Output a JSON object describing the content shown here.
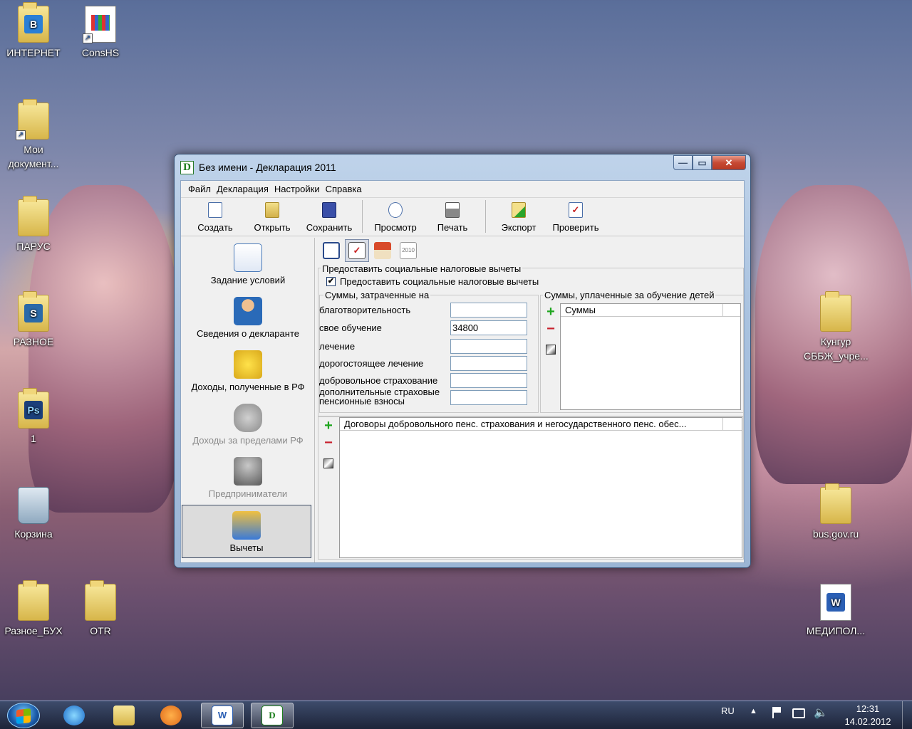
{
  "desktop": {
    "icons": [
      {
        "label": "ИНТЕРНЕТ",
        "icon": "folder-icon"
      },
      {
        "label": "ConsHS",
        "icon": "application-icon"
      },
      {
        "label": "Мои документ...",
        "icon": "folder-shortcut-icon"
      },
      {
        "label": "ПАРУС",
        "icon": "folder-icon"
      },
      {
        "label": "РАЗНОЕ",
        "icon": "folder-icon"
      },
      {
        "label": "1",
        "icon": "photoshop-folder-icon"
      },
      {
        "label": "Корзина",
        "icon": "recycle-bin-icon"
      },
      {
        "label": "Разное_БУХ",
        "icon": "folder-icon"
      },
      {
        "label": "OTR",
        "icon": "folder-icon"
      },
      {
        "label": "Кунгур СББЖ_учре...",
        "icon": "folder-icon"
      },
      {
        "label": "bus.gov.ru",
        "icon": "folder-icon"
      },
      {
        "label": "МЕДИПОЛ...",
        "icon": "word-document-icon"
      }
    ]
  },
  "window": {
    "title": "Без имени - Декларация 2011",
    "app_icon_letter": "D"
  },
  "menu": [
    "Файл",
    "Декларация",
    "Настройки",
    "Справка"
  ],
  "toolbar": {
    "create": "Создать",
    "open": "Открыть",
    "save": "Сохранить",
    "preview": "Просмотр",
    "print": "Печать",
    "export": "Экспорт",
    "check": "Проверить"
  },
  "nav": [
    {
      "label": "Задание условий",
      "enabled": true
    },
    {
      "label": "Сведения о декларанте",
      "enabled": true
    },
    {
      "label": "Доходы, полученные в РФ",
      "enabled": true
    },
    {
      "label": "Доходы за пределами РФ",
      "enabled": false
    },
    {
      "label": "Предприниматели",
      "enabled": false
    },
    {
      "label": "Вычеты",
      "enabled": true,
      "selected": true
    }
  ],
  "tabs": {
    "year_badge": "2010"
  },
  "social": {
    "group_title": "Предоставить социальные налоговые вычеты",
    "checkbox_label": "Предоставить социальные налоговые вычеты",
    "checked": true,
    "sums_title": "Суммы, затраченные на",
    "fields": [
      {
        "label": "благотворительность",
        "value": ""
      },
      {
        "label": "свое обучение",
        "value": "34800"
      },
      {
        "label": "лечение",
        "value": ""
      },
      {
        "label": "дорогостоящее лечение",
        "value": ""
      },
      {
        "label": "добровольное страхование",
        "value": ""
      },
      {
        "label": "дополнительные страховые пенсионные взносы",
        "value": ""
      }
    ],
    "children_title": "Суммы, уплаченные за обучение детей",
    "children_col": "Суммы",
    "contracts_col": "Договоры добровольного пенс. страхования и негосударственного пенс. обес..."
  },
  "taskbar": {
    "lang": "RU",
    "time": "12:31",
    "date": "14.02.2012"
  },
  "colors": {
    "accent_green": "#1ea51e",
    "accent_red": "#c8202c",
    "window_frame": "#a9c2df"
  }
}
